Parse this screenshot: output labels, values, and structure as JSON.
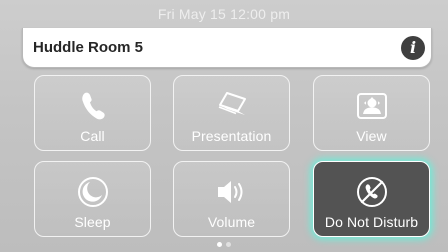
{
  "status_bar": {
    "datetime": "Fri May 15  12:00 pm"
  },
  "header": {
    "room_name": "Huddle Room 5",
    "info_icon": "info-icon"
  },
  "tiles": [
    {
      "label": "Call",
      "icon": "phone-icon"
    },
    {
      "label": "Presentation",
      "icon": "laptop-icon"
    },
    {
      "label": "View",
      "icon": "camera-view-icon"
    },
    {
      "label": "Sleep",
      "icon": "moon-icon"
    },
    {
      "label": "Volume",
      "icon": "speaker-icon"
    },
    {
      "label": "Do Not Disturb",
      "icon": "no-phone-icon",
      "active": true
    }
  ],
  "pager": {
    "pages": 2,
    "current": 1
  },
  "colors": {
    "active_glow": "#6eebd7",
    "active_bg": "#535353"
  }
}
